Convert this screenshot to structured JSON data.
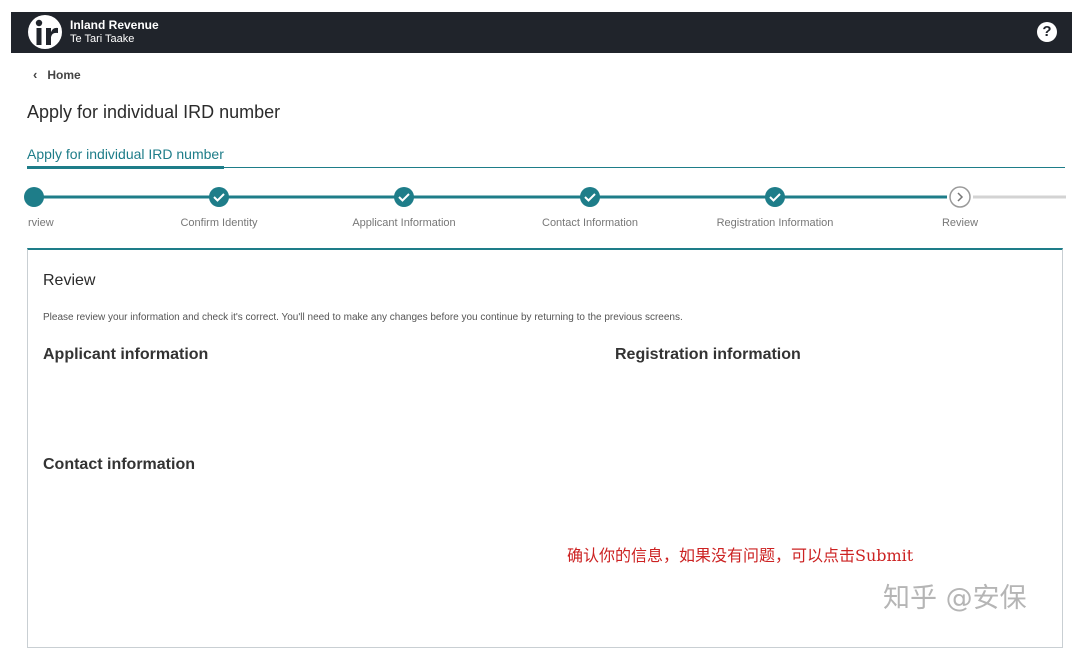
{
  "header": {
    "brand_en": "Inland Revenue",
    "brand_mi": "Te Tari Taake",
    "help_label": "?",
    "bg_color": "#20242b"
  },
  "breadcrumb": {
    "chevron": "‹",
    "label": "Home"
  },
  "page_title": "Apply for individual IRD number",
  "tabs": [
    {
      "label": "Apply for individual IRD number",
      "active": true
    }
  ],
  "stepper": {
    "accent": "#1e7d89",
    "steps": [
      {
        "label": "rview",
        "state": "complete"
      },
      {
        "label": "Confirm Identity",
        "state": "complete"
      },
      {
        "label": "Applicant Information",
        "state": "complete"
      },
      {
        "label": "Contact Information",
        "state": "complete"
      },
      {
        "label": "Registration Information",
        "state": "complete"
      },
      {
        "label": "Review",
        "state": "current"
      }
    ]
  },
  "review": {
    "title": "Review",
    "description": "Please review your information and check it's correct. You'll need to make any changes before you continue by returning to the previous screens.",
    "sections": {
      "applicant": "Applicant information",
      "registration": "Registration information",
      "contact": "Contact information"
    }
  },
  "overlay": {
    "annotation": "确认你的信息，如果没有问题，可以点击Submit",
    "watermark": "知乎 @安保"
  }
}
